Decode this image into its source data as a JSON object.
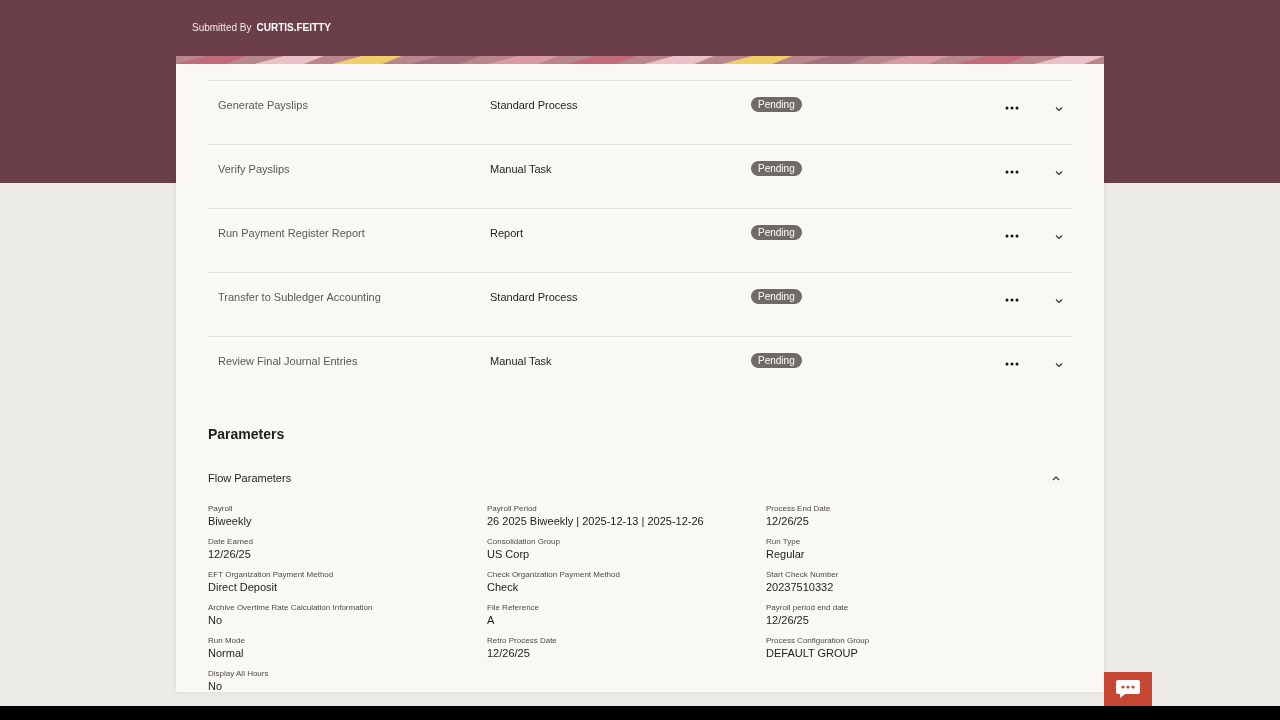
{
  "header": {
    "submitted_by_label": "Submitted By",
    "submitted_by": "CURTIS.FEITTY"
  },
  "tasks": [
    {
      "name": "Generate Payslips",
      "type": "Standard Process",
      "status": "Pending",
      "expanded": false
    },
    {
      "name": "Verify Payslips",
      "type": "Manual Task",
      "status": "Pending",
      "expanded": false
    },
    {
      "name": "Run Payment Register Report",
      "type": "Report",
      "status": "Pending",
      "expanded": false
    },
    {
      "name": "Transfer to Subledger Accounting",
      "type": "Standard Process",
      "status": "Pending",
      "expanded": false
    },
    {
      "name": "Review Final Journal Entries",
      "type": "Manual Task",
      "status": "Pending",
      "expanded": false
    }
  ],
  "parameters": {
    "title": "Parameters",
    "section": {
      "title": "Flow Parameters",
      "expanded": true,
      "fields": [
        {
          "label": "Payroll",
          "value": "Biweekly"
        },
        {
          "label": "Payroll Period",
          "value": "26 2025 Biweekly | 2025-12-13 | 2025-12-26"
        },
        {
          "label": "Process End Date",
          "value": "12/26/25"
        },
        {
          "label": "Date Earned",
          "value": "12/26/25"
        },
        {
          "label": "Consolidation Group",
          "value": "US Corp"
        },
        {
          "label": "Run Type",
          "value": "Regular"
        },
        {
          "label": "EFT Organization Payment Method",
          "value": "Direct Deposit"
        },
        {
          "label": "Check Organization Payment Method",
          "value": "Check"
        },
        {
          "label": "Start Check Number",
          "value": "20237510332"
        },
        {
          "label": "Archive Overtime Rate Calculation Information",
          "value": "No"
        },
        {
          "label": "File Reference",
          "value": "A"
        },
        {
          "label": "Payroll period end date",
          "value": "12/26/25"
        },
        {
          "label": "Run Mode",
          "value": "Normal"
        },
        {
          "label": "Retro Process Date",
          "value": "12/26/25"
        },
        {
          "label": "Process Configuration Group",
          "value": "DEFAULT GROUP"
        },
        {
          "label": "Display All Hours",
          "value": "No"
        }
      ]
    }
  }
}
